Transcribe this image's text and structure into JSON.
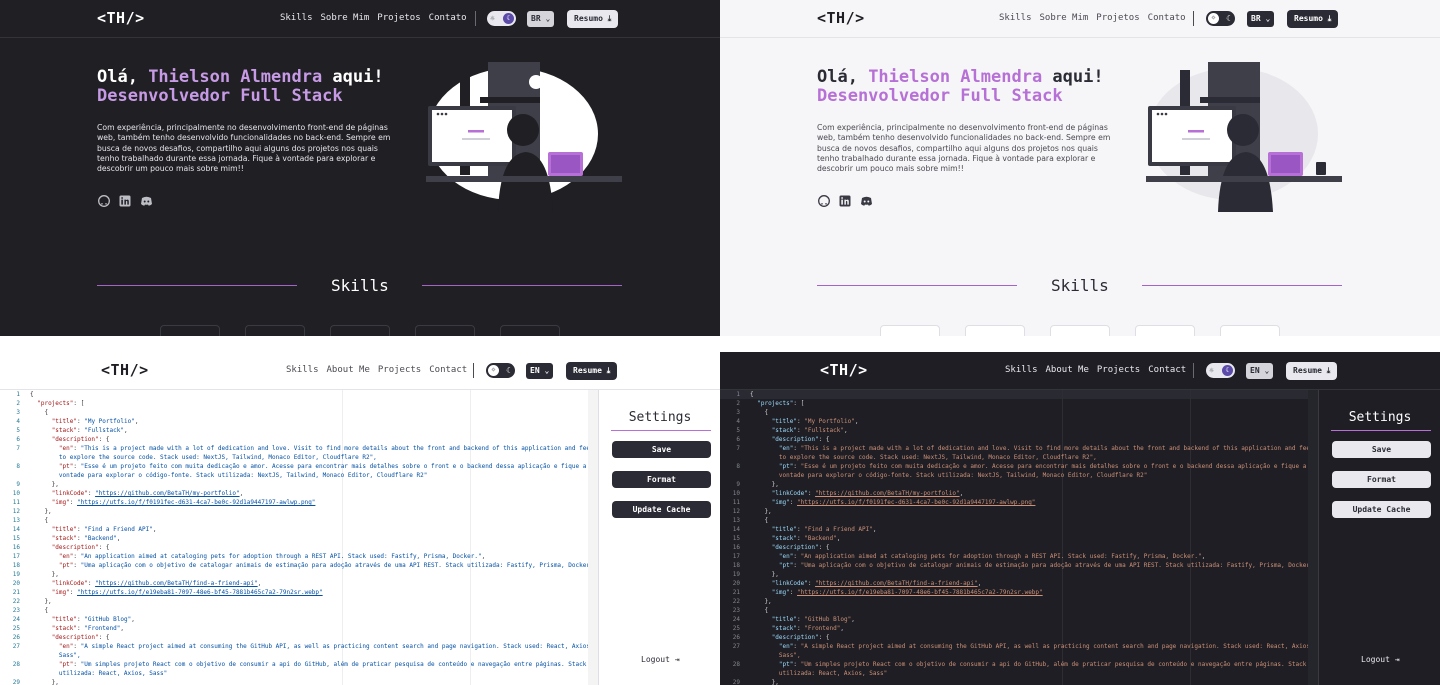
{
  "colors": {
    "accent": "#b670d6",
    "dark_bg": "#1f1f24",
    "light_bg": "#f6f6f8"
  },
  "portfolio_pt": {
    "logo": "<TH/>",
    "nav": [
      "Skills",
      "Sobre Mim",
      "Projetos",
      "Contato"
    ],
    "lang": "BR ⌄",
    "resume": "Resumo ⤓",
    "greet_prefix": "Olá, ",
    "name": "Thielson Almendra",
    "greet_suffix": " aqui!",
    "role": "Desenvolvedor Full Stack",
    "paragraph": "Com experiência, principalmente no desenvolvimento front-end de páginas web, também tenho desenvolvido funcionalidades no back-end. Sempre em busca de novos desafios, compartilho aqui alguns dos projetos nos quais tenho trabalhado durante essa jornada. Fique à vontade para explorar e descobrir um pouco mais sobre mim!!",
    "socials": [
      "github-icon",
      "linkedin-icon",
      "discord-icon"
    ],
    "skills_title": "Skills"
  },
  "editor_en": {
    "logo": "<TH/>",
    "nav": [
      "Skills",
      "About Me",
      "Projects",
      "Contact"
    ],
    "lang": "EN ⌄",
    "resume": "Resume ⤓",
    "settings_title": "Settings",
    "buttons": [
      "Save",
      "Format",
      "Update Cache"
    ],
    "logout": "Logout ⇥",
    "lines": [
      {
        "n": "1",
        "t": "{"
      },
      {
        "n": "2",
        "t": "  \"projects\": ["
      },
      {
        "n": "3",
        "t": "    {"
      },
      {
        "n": "4",
        "t": "      \"title\": \"My Portfolio\","
      },
      {
        "n": "5",
        "t": "      \"stack\": \"Fullstack\","
      },
      {
        "n": "6",
        "t": "      \"description\": {"
      },
      {
        "n": "7",
        "t": "        \"en\": \"This is a project made with a lot of dedication and love. Visit to find more details about the front and backend of this application and feel free"
      },
      {
        "n": "",
        "t": "        to explore the source code. Stack used: NextJS, Tailwind, Monaco Editor, Cloudflare R2\","
      },
      {
        "n": "8",
        "t": "        \"pt\": \"Esse é um projeto feito com muita dedicação e amor. Acesse para encontrar mais detalhes sobre o front e o backend dessa aplicação e fique a"
      },
      {
        "n": "",
        "t": "        vontade para explorar o código-fonte. Stack utilizada: NextJS, Tailwind, Monaco Editor, Cloudflare R2\""
      },
      {
        "n": "9",
        "t": "      },"
      },
      {
        "n": "10",
        "t": "      \"linkCode\": \"https://github.com/BetaTH/my-portfolio\","
      },
      {
        "n": "11",
        "t": "      \"img\": \"https://utfs.io/f/f0191fec-d631-4ca7-be0c-92d1a9447197-awlwp.png\""
      },
      {
        "n": "12",
        "t": "    },"
      },
      {
        "n": "13",
        "t": "    {"
      },
      {
        "n": "14",
        "t": "      \"title\": \"Find a Friend API\","
      },
      {
        "n": "15",
        "t": "      \"stack\": \"Backend\","
      },
      {
        "n": "16",
        "t": "      \"description\": {"
      },
      {
        "n": "17",
        "t": "        \"en\": \"An application aimed at cataloging pets for adoption through a REST API. Stack used: Fastify, Prisma, Docker.\","
      },
      {
        "n": "18",
        "t": "        \"pt\": \"Uma aplicação com o objetivo de catalogar animais de estimação para adoção através de uma API REST. Stack utilizada: Fastify, Prisma, Docker\""
      },
      {
        "n": "19",
        "t": "      },"
      },
      {
        "n": "20",
        "t": "      \"linkCode\": \"https://github.com/BetaTH/find-a-friend-api\","
      },
      {
        "n": "21",
        "t": "      \"img\": \"https://utfs.io/f/e19eba81-7097-48e6-bf45-7881b465c7a2-79n2sr.webp\""
      },
      {
        "n": "22",
        "t": "    },"
      },
      {
        "n": "23",
        "t": "    {"
      },
      {
        "n": "24",
        "t": "      \"title\": \"GitHub Blog\","
      },
      {
        "n": "25",
        "t": "      \"stack\": \"Frontend\","
      },
      {
        "n": "26",
        "t": "      \"description\": {"
      },
      {
        "n": "27",
        "t": "        \"en\": \"A simple React project aimed at consuming the GitHub API, as well as practicing content search and page navigation. Stack used: React, Axios,"
      },
      {
        "n": "",
        "t": "        Sass\","
      },
      {
        "n": "28",
        "t": "        \"pt\": \"Um simples projeto React com o objetivo de consumir a api do GitHub, além de praticar pesquisa de conteúdo e navegação entre páginas. Stack"
      },
      {
        "n": "",
        "t": "        utilizada: React, Axios, Sass\""
      },
      {
        "n": "29",
        "t": "      },"
      }
    ]
  }
}
